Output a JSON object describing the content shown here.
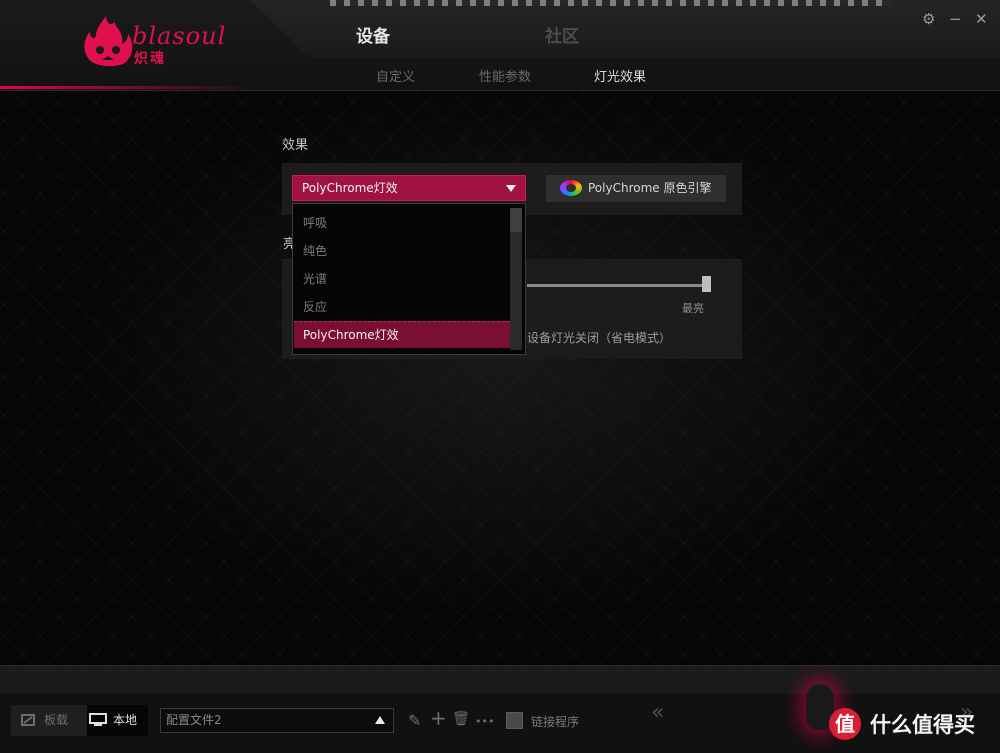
{
  "app": {
    "logo_text": "blasoul",
    "logo_sub": "炽魂"
  },
  "header": {
    "main_tabs": [
      {
        "label": "设备",
        "active": true
      },
      {
        "label": "社区",
        "active": false
      }
    ],
    "sub_tabs": [
      {
        "label": "自定义",
        "active": false
      },
      {
        "label": "性能参数",
        "active": false
      },
      {
        "label": "灯光效果",
        "active": true
      }
    ],
    "settings_glyph": "⚙",
    "minimize_glyph": "−",
    "close_glyph": "✕"
  },
  "effect": {
    "section_label": "效果",
    "selected": "PolyChrome灯效",
    "options": [
      "呼吸",
      "纯色",
      "光谱",
      "反应",
      "PolyChrome灯效"
    ],
    "polychrome_button": "PolyChrome 原色引擎",
    "brightness_label_partial": "亮",
    "brightness_max_label": "最亮",
    "brightness_value": 1.0,
    "power_save_text": "设备灯光关闭（省电模式）"
  },
  "footer": {
    "onboard_label": "板载",
    "local_label": "本地",
    "profile_value": "配置文件2",
    "link_label": "链接程序",
    "edit_glyph": "✎",
    "add_glyph": "+",
    "delete_glyph": "🗑",
    "more_glyph": "•••",
    "chevron_left": "«",
    "chevron_right": "»"
  },
  "watermark": {
    "badge": "值",
    "text": "什么值得买"
  },
  "colors": {
    "accent": "#e5004f",
    "selected_fill": "#a0123f"
  }
}
